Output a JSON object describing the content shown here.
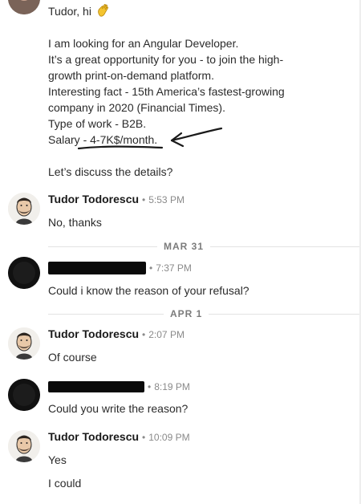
{
  "first_message": {
    "greeting": "Tudor, hi",
    "lines": [
      "I am looking for an Angular Developer.",
      "It’s a great opportunity for you - to join the high-",
      "growth print-on-demand platform.",
      "Interesting fact - 15th America’s fastest-growing",
      "company in 2020 (Financial Times).",
      "Type of work - B2B."
    ],
    "salary_prefix": "Salary - ",
    "salary_value": "4-7K$/month",
    "salary_suffix": ".",
    "closing": "Let’s discuss the details?"
  },
  "messages": [
    {
      "sender": "Tudor Todorescu",
      "time": "5:53 PM",
      "texts": [
        "No, thanks"
      ]
    },
    {
      "sender": "",
      "time": "7:37 PM",
      "texts": [
        "Could i know the reason of your refusal?"
      ]
    },
    {
      "sender": "Tudor Todorescu",
      "time": "2:07 PM",
      "texts": [
        "Of course"
      ]
    },
    {
      "sender": "",
      "time": "8:19 PM",
      "texts": [
        "Could you write the reason?"
      ]
    },
    {
      "sender": "Tudor Todorescu",
      "time": "10:09 PM",
      "texts": [
        "Yes",
        "I could"
      ]
    }
  ],
  "dividers": [
    "MAR 31",
    "APR 1"
  ],
  "icons": {
    "waving_hand": "waving-hand-icon",
    "arrow_annotation": "arrow-annotation",
    "underline_annotation": "underline-annotation"
  },
  "colors": {
    "annotation": "#1a1a1a",
    "divider": "#e3e3e3",
    "redaction": "#0a0a0a"
  }
}
